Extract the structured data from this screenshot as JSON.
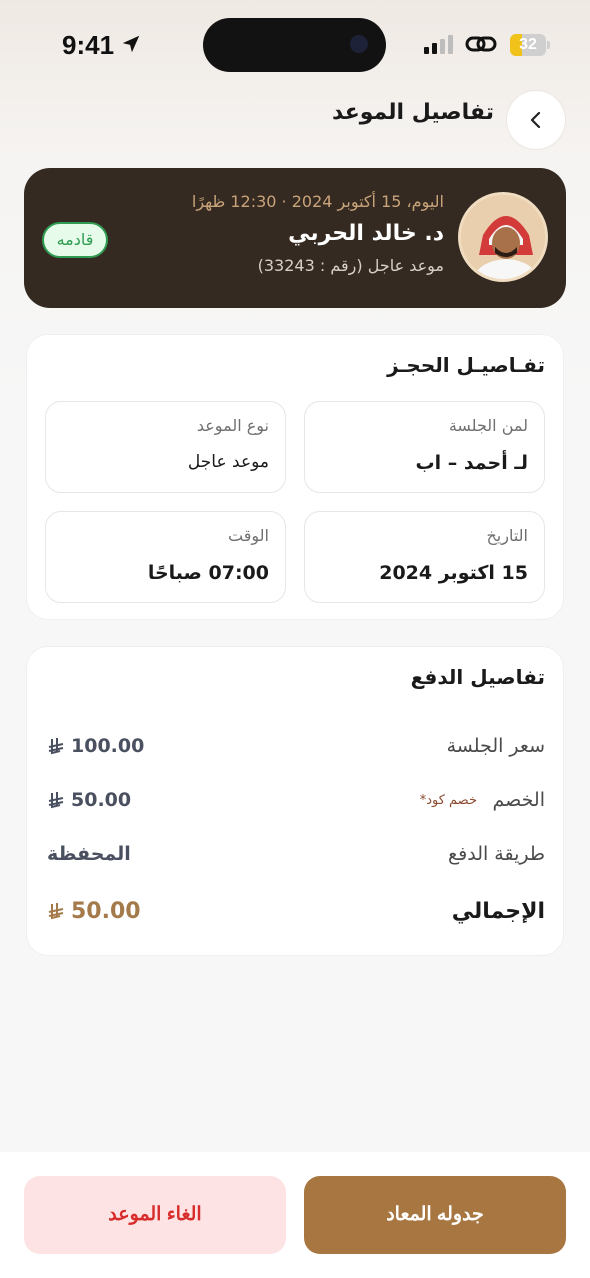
{
  "status_bar": {
    "time": "9:41",
    "battery": "32",
    "battery_level_percent": 32,
    "icons": [
      "location-arrow-icon",
      "signal-icon",
      "link-icon",
      "battery-icon"
    ]
  },
  "header": {
    "title": "تفاصيل الموعد",
    "back_icon": "chevron-right-icon"
  },
  "doctor_card": {
    "date_time": "اليوم، 15 أكتوبر 2024 · 12:30 ظهرًا",
    "doctor_name": "د. خالد الحربي",
    "appointment_info": "موعد عاجل  (رقم : 33243)",
    "status": "قادمه",
    "colors": {
      "card_bg": "#342a21",
      "status_green": "#2f9c52"
    }
  },
  "booking": {
    "title": "تفـاصيـل الحجـز",
    "fields": [
      {
        "label": "لمن الجلسة",
        "value": "لـ أحمد – اب"
      },
      {
        "label": "نوع الموعد",
        "value": "موعد عاجل"
      },
      {
        "label": "التاريخ",
        "value": "15 اكتوبر 2024"
      },
      {
        "label": "الوقت",
        "value": "07:00 صباحًا"
      }
    ]
  },
  "payment": {
    "title": "تفاصيل الدفع",
    "rows": [
      {
        "label": "سعر الجلسة",
        "value": "100.00"
      },
      {
        "label": "الخصم",
        "code_label": "خصم كود*",
        "value": "50.00"
      },
      {
        "label": "طريقة الدفع",
        "value": "المحفظة"
      }
    ],
    "total_label": "الإجمالي",
    "total_value": "50.00",
    "currency_icon": "saudi-riyal-icon"
  },
  "actions": {
    "reschedule": "جدوله المعاد",
    "cancel": "الغاء الموعد",
    "colors": {
      "primary": "#a87641",
      "danger": "#d82c2c",
      "danger_bg": "#fde3e3"
    }
  }
}
